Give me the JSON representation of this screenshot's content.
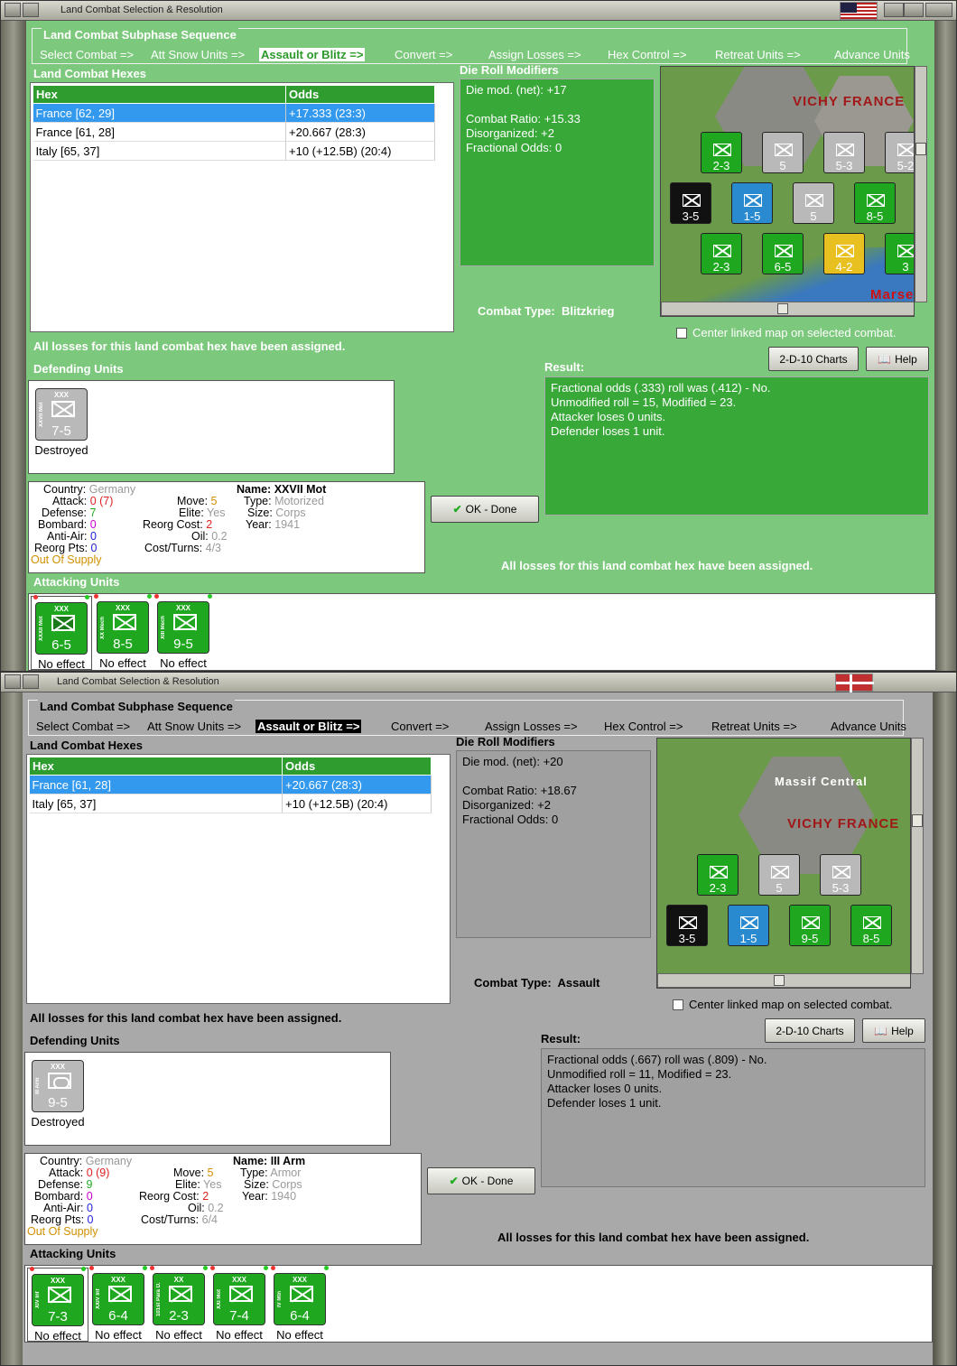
{
  "windows": [
    {
      "title": "Land Combat Selection & Resolution",
      "flag": "us",
      "sequence_title": "Land Combat Subphase Sequence",
      "sequence": [
        "Select Combat =>",
        "Att Snow Units =>",
        "Assault or Blitz =>",
        "Convert =>",
        "Assign Losses =>",
        "Hex Control =>",
        "Retreat Units =>",
        "Advance Units"
      ],
      "active_step": 2,
      "hexes_label": "Land Combat Hexes",
      "hex_header": "Hex",
      "odds_header": "Odds",
      "hexes": [
        {
          "hex": "France [62, 29]",
          "odds": "+17.333 (23:3)"
        },
        {
          "hex": "France [61, 28]",
          "odds": "+20.667 (28:3)"
        },
        {
          "hex": "Italy [65, 37]",
          "odds": "+10 (+12.5B) (20:4)"
        }
      ],
      "selected_hex": 0,
      "drm_label": "Die Roll Modifiers",
      "drm": [
        "Die mod. (net): +17",
        "",
        "Combat Ratio: +15.33",
        "Disorganized: +2",
        "Fractional Odds: 0"
      ],
      "combat_type_label": "Combat Type:",
      "combat_type": "Blitzkrieg",
      "map_labels": [
        "VICHY FRANCE",
        "Marse"
      ],
      "center_label": "Center linked map on selected combat.",
      "assigned_msg": "All losses for this land combat hex have been assigned.",
      "defending_label": "Defending Units",
      "defenders": [
        {
          "name": "XXVII Mot",
          "size": "XXX",
          "val": "7-5",
          "status": "Destroyed",
          "color": "#b9b9b9",
          "sym": "inf"
        }
      ],
      "btn_charts": "2-D-10 Charts",
      "btn_help": "Help",
      "btn_ok": "OK - Done",
      "result_label": "Result:",
      "result": [
        "Fractional odds (.333) roll was (.412)  - No.",
        "Unmodified roll = 15, Modified = 23.",
        "Attacker loses 0 units.",
        "Defender loses 1 unit."
      ],
      "info": {
        "country_k": "Country:",
        "country": "Germany",
        "attack_k": "Attack:",
        "attack": "0",
        "attack2": "(7)",
        "defense_k": "Defense:",
        "defense": "7",
        "bombard_k": "Bombard:",
        "bombard": "0",
        "antiair_k": "Anti-Air:",
        "antiair": "0",
        "reorgpts_k": "Reorg Pts:",
        "reorgpts": "0",
        "supply": "Out Of Supply",
        "move_k": "Move:",
        "move": "5",
        "elite_k": "Elite:",
        "elite": "Yes",
        "reorgcost_k": "Reorg Cost:",
        "reorgcost": "2",
        "oil_k": "Oil:",
        "oil": "0.2",
        "costturns_k": "Cost/Turns:",
        "costturns": "4/3",
        "name_k": "Name:",
        "name": "XXVII Mot",
        "type_k": "Type:",
        "type": "Motorized",
        "size_k": "Size:",
        "size": "Corps",
        "year_k": "Year:",
        "year": "1941"
      },
      "attacking_label": "Attacking Units",
      "attackers": [
        {
          "name": "XXXII Mot",
          "size": "XXX",
          "val": "6-5",
          "status": "No effect",
          "sym": "inf"
        },
        {
          "name": "XX Mech",
          "size": "XXX",
          "val": "8-5",
          "status": "No effect",
          "sym": "inf"
        },
        {
          "name": "XIII Mech",
          "size": "XXX",
          "val": "9-5",
          "status": "No effect",
          "sym": "inf"
        }
      ]
    },
    {
      "title": "Land Combat Selection & Resolution",
      "flag": "de",
      "sequence_title": "Land Combat Subphase Sequence",
      "sequence": [
        "Select Combat =>",
        "Att Snow Units =>",
        "Assault or Blitz =>",
        "Convert =>",
        "Assign Losses =>",
        "Hex Control =>",
        "Retreat Units =>",
        "Advance Units"
      ],
      "active_step": 2,
      "hexes_label": "Land Combat Hexes",
      "hex_header": "Hex",
      "odds_header": "Odds",
      "hexes": [
        {
          "hex": "France [61, 28]",
          "odds": "+20.667 (28:3)"
        },
        {
          "hex": "Italy [65, 37]",
          "odds": "+10 (+12.5B) (20:4)"
        }
      ],
      "selected_hex": 0,
      "drm_label": "Die Roll Modifiers",
      "drm": [
        "Die mod. (net): +20",
        "",
        "Combat Ratio: +18.67",
        "Disorganized: +2",
        "Fractional Odds: 0"
      ],
      "combat_type_label": "Combat Type:",
      "combat_type": "Assault",
      "map_labels": [
        "Massif Central",
        "VICHY FRANCE"
      ],
      "center_label": "Center linked map on selected combat.",
      "assigned_msg": "All losses for this land combat hex have been assigned.",
      "defending_label": "Defending Units",
      "defenders": [
        {
          "name": "III Arm",
          "size": "XXX",
          "val": "9-5",
          "status": "Destroyed",
          "color": "#b9b9b9",
          "sym": "arm"
        }
      ],
      "btn_charts": "2-D-10 Charts",
      "btn_help": "Help",
      "btn_ok": "OK - Done",
      "result_label": "Result:",
      "result": [
        "Fractional odds (.667) roll was (.809)  - No.",
        "Unmodified roll = 11, Modified = 23.",
        "Attacker loses 0 units.",
        "Defender loses 1 unit."
      ],
      "info": {
        "country_k": "Country:",
        "country": "Germany",
        "attack_k": "Attack:",
        "attack": "0",
        "attack2": "(9)",
        "defense_k": "Defense:",
        "defense": "9",
        "bombard_k": "Bombard:",
        "bombard": "0",
        "antiair_k": "Anti-Air:",
        "antiair": "0",
        "reorgpts_k": "Reorg Pts:",
        "reorgpts": "0",
        "supply": "Out Of Supply",
        "move_k": "Move:",
        "move": "5",
        "elite_k": "Elite:",
        "elite": "Yes",
        "reorgcost_k": "Reorg Cost:",
        "reorgcost": "2",
        "oil_k": "Oil:",
        "oil": "0.2",
        "costturns_k": "Cost/Turns:",
        "costturns": "6/4",
        "name_k": "Name:",
        "name": "III Arm",
        "type_k": "Type:",
        "type": "Armor",
        "size_k": "Size:",
        "size": "Corps",
        "year_k": "Year:",
        "year": "1940"
      },
      "attacking_label": "Attacking Units",
      "attackers": [
        {
          "name": "XIV Inf",
          "size": "XXX",
          "val": "7-3",
          "status": "No effect",
          "sym": "inf"
        },
        {
          "name": "XXIV Inf",
          "size": "XXX",
          "val": "6-4",
          "status": "No effect",
          "sym": "inf"
        },
        {
          "name": "101st Para D.",
          "size": "XX",
          "val": "2-3",
          "status": "No effect",
          "sym": "inf"
        },
        {
          "name": "XXI Mot",
          "size": "XXX",
          "val": "7-4",
          "status": "No effect",
          "sym": "inf"
        },
        {
          "name": "IV Mtn",
          "size": "XXX",
          "val": "6-4",
          "status": "No effect",
          "sym": "mnt"
        }
      ]
    }
  ],
  "map_counters": {
    "w1": [
      {
        "v": "2-3",
        "c": "g"
      },
      {
        "v": "5",
        "c": "gr"
      },
      {
        "v": "5-3",
        "c": "gr"
      },
      {
        "v": "5-2",
        "c": "gr"
      },
      {
        "v": "3-5",
        "c": "bk"
      },
      {
        "v": "1-5",
        "c": "bl"
      },
      {
        "v": "5",
        "c": "gr"
      },
      {
        "v": "8-5",
        "c": "g"
      },
      {
        "v": "2-3",
        "c": "g"
      },
      {
        "v": "6-5",
        "c": "g"
      },
      {
        "v": "4-2",
        "c": "yl"
      },
      {
        "v": "3",
        "c": "g"
      }
    ],
    "w2": [
      {
        "v": "2-3",
        "c": "g"
      },
      {
        "v": "5",
        "c": "gr"
      },
      {
        "v": "5-3",
        "c": "gr"
      },
      {
        "v": "3-5",
        "c": "bk"
      },
      {
        "v": "1-5",
        "c": "bl"
      },
      {
        "v": "9-5",
        "c": "g"
      },
      {
        "v": "8-5",
        "c": "g"
      }
    ]
  }
}
